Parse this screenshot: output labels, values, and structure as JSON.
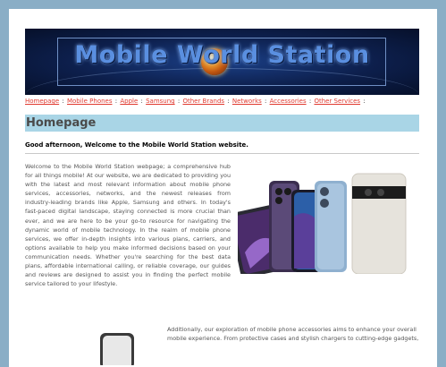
{
  "banner": {
    "logo_text": "Mobile World Station",
    "colors": {
      "background": "#0d1f4c",
      "text": "#5a8fe0",
      "globe": "#f0a030"
    }
  },
  "breadcrumb": {
    "items": [
      {
        "label": "Homepage"
      },
      {
        "label": "Mobile Phones"
      },
      {
        "label": "Apple"
      },
      {
        "label": "Samsung"
      },
      {
        "label": "Other Brands"
      },
      {
        "label": "Networks"
      },
      {
        "label": "Accessories"
      },
      {
        "label": "Other Services"
      }
    ],
    "separator": ":"
  },
  "page": {
    "title": "Homepage",
    "greeting": "Good afternoon, Welcome to the Mobile World Station website.",
    "intro": "Welcome to the Mobile World Station webpage; a comprehensive hub for all things mobile! At our website, we are dedicated to providing you with the latest and most relevant information about mobile phone services, accessories, networks, and the newest releases from industry-leading brands like Apple, Samsung and others. In today's fast-paced digital landscape, staying connected is more crucial than ever, and we are here to be your go-to resource for navigating the dynamic world of mobile technology. In the realm of mobile phone services, we offer in-depth insights into various plans, carriers, and options available to help you make informed decisions based on your communication needs. Whether you're searching for the best data plans, affordable international calling, or reliable coverage, our guides and reviews are designed to assist you in finding the perfect mobile service tailored to your lifestyle.",
    "accessories_text": "Additionally, our exploration of mobile phone accessories aims to enhance your overall mobile experience. From protective cases and stylish chargers to cutting-edge gadgets,"
  },
  "colors": {
    "page_bg": "#8aaec6",
    "title_bar": "#a9d5e6",
    "link": "#e03a30"
  }
}
